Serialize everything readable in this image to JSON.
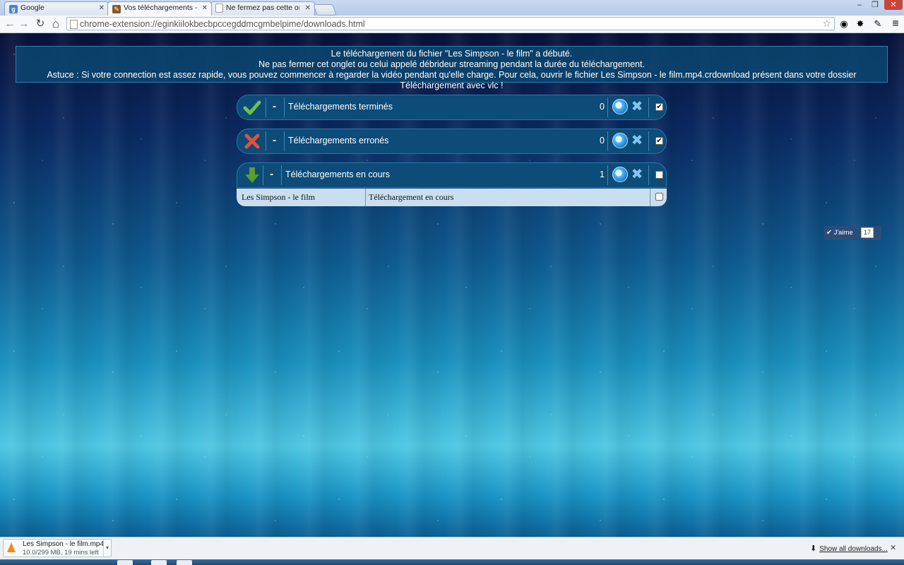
{
  "browser": {
    "tabs": [
      {
        "title": "Google",
        "favicon": "google-g-icon",
        "active": false
      },
      {
        "title": "Vos téléchargements - Ko",
        "favicon": "puzzle-extension-icon",
        "active": true
      },
      {
        "title": "Ne fermez pas cette ongle",
        "favicon": "blank-page-icon",
        "active": false
      }
    ],
    "close_glyph": "✕",
    "window_controls": {
      "minimize": "–",
      "maximize": "❐",
      "close": "✕"
    },
    "nav": {
      "back": "←",
      "forward": "→",
      "reload": "↻",
      "home": "⌂"
    },
    "url": "chrome-extension://eginkiilokbecbpccegddmcgmbelpime/downloads.html",
    "star": "☆",
    "extensions": [
      {
        "name": "gray-extension-icon",
        "glyph": "◉",
        "color": "#9aa0a6"
      },
      {
        "name": "red-gear-extension-icon",
        "glyph": "✸",
        "color": "#c8102e"
      },
      {
        "name": "brown-extension-icon",
        "glyph": "✎",
        "color": "#8a5a2b"
      },
      {
        "name": "menu-icon",
        "glyph": "≡",
        "color": "#555555"
      }
    ]
  },
  "notice": {
    "line1": "Le téléchargement du fichier \"Les Simpson - le film\" a débuté.",
    "line2": "Ne pas fermer cet onglet ou celui appelé débrideur streaming pendant la durée du téléchargement.",
    "line3": "Astuce : Si votre connection est assez rapide, vous pouvez commencer à regarder la vidéo pendant qu'elle charge. Pour cela, ouvrir le fichier Les Simpson - le film.mp4.crdownload présent dans votre dossier Téléchargement avec vlc !"
  },
  "sections": {
    "done": {
      "icon": "green-check-icon",
      "dash": "-",
      "label": "Téléchargements terminés",
      "count": "0",
      "checked": true
    },
    "error": {
      "icon": "red-x-icon",
      "dash": "-",
      "label": "Téléchargements erronés",
      "count": "0",
      "checked": true
    },
    "active": {
      "icon": "green-down-arrow-icon",
      "dash": "-",
      "label": "Téléchargements en cours",
      "count": "1",
      "checked": false
    }
  },
  "check_glyph": "✔",
  "x_glyph": "✖",
  "active_downloads": [
    {
      "name": "Les Simpson - le film",
      "status": "Téléchargement en cours"
    }
  ],
  "like": {
    "label": "J'aime",
    "count": "17"
  },
  "shelf": {
    "file": "Les Simpson - le film.mp4",
    "progress": "10.0/299 MB, 19 mins left",
    "show_all": "Show all downloads...",
    "close": "✕",
    "menu_arrow": "▾",
    "download_glyph": "⬇"
  },
  "colors": {
    "panel": "#0d4b78",
    "notice_bg": "#0a466e",
    "row_bg": "#c9dff0",
    "check_green": "#6cc24a",
    "error_red": "#e2503a",
    "arrow_green": "#5a9e2f"
  }
}
